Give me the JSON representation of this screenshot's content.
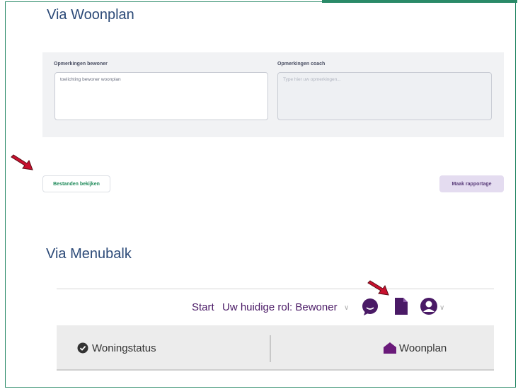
{
  "sections": {
    "woonplan_heading": "Via Woonplan",
    "menubalk_heading": "Via Menubalk"
  },
  "form": {
    "resident_label": "Opmerkingen bewoner",
    "resident_value": "toelichting bewoner woonplan",
    "coach_label": "Opmerkingen coach",
    "coach_placeholder": "Type hier uw opmerkingen..."
  },
  "buttons": {
    "view_files": "Bestanden bekijken",
    "make_report": "Maak rapportage"
  },
  "menubar": {
    "start": "Start",
    "role": "Uw huidige rol: Bewoner"
  },
  "subbar": {
    "status": "Woningstatus",
    "plan": "Woonplan"
  },
  "colors": {
    "frame": "#2a8a68",
    "heading": "#2c4a78",
    "nav": "#4a1a66",
    "arrow": "#c8102e"
  },
  "icons": [
    "chat-bubble-icon",
    "document-icon",
    "user-circle-icon",
    "check-circle-icon",
    "house-icon",
    "chevron-down-icon",
    "red-arrow"
  ]
}
